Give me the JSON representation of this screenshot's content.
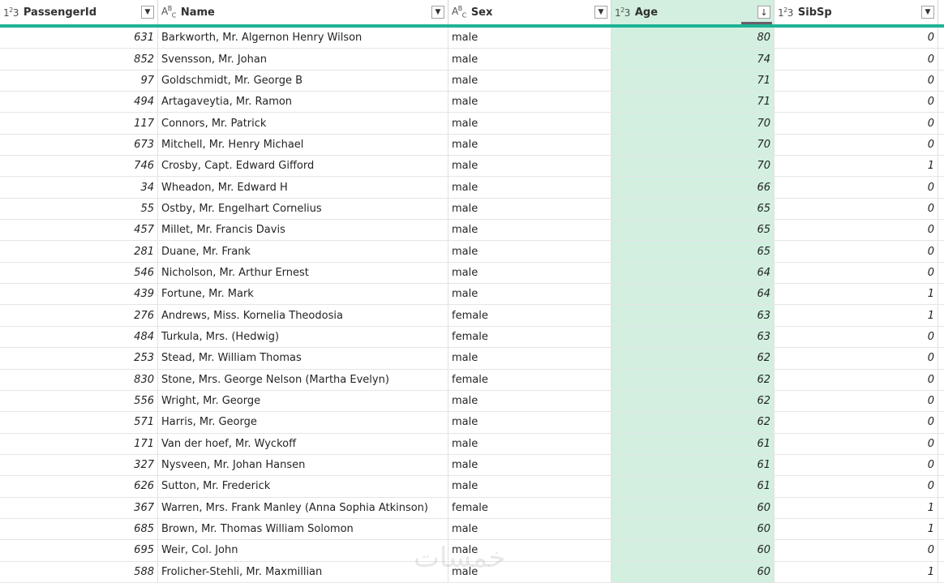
{
  "columns": {
    "passengerid": {
      "type_icon": "1²3",
      "name": "PassengerId"
    },
    "name": {
      "type_icon": "ABC",
      "name": "Name"
    },
    "sex": {
      "type_icon": "ABC",
      "name": "Sex"
    },
    "age": {
      "type_icon": "1²3",
      "name": "Age",
      "sort": "descending"
    },
    "sibsp": {
      "type_icon": "1²3",
      "name": "SibSp"
    }
  },
  "rows": [
    {
      "pid": "631",
      "name": "Barkworth, Mr. Algernon Henry Wilson",
      "sex": "male",
      "age": "80",
      "sibsp": "0"
    },
    {
      "pid": "852",
      "name": "Svensson, Mr. Johan",
      "sex": "male",
      "age": "74",
      "sibsp": "0"
    },
    {
      "pid": "97",
      "name": "Goldschmidt, Mr. George B",
      "sex": "male",
      "age": "71",
      "sibsp": "0"
    },
    {
      "pid": "494",
      "name": "Artagaveytia, Mr. Ramon",
      "sex": "male",
      "age": "71",
      "sibsp": "0"
    },
    {
      "pid": "117",
      "name": "Connors, Mr. Patrick",
      "sex": "male",
      "age": "70",
      "sibsp": "0"
    },
    {
      "pid": "673",
      "name": "Mitchell, Mr. Henry Michael",
      "sex": "male",
      "age": "70",
      "sibsp": "0"
    },
    {
      "pid": "746",
      "name": "Crosby, Capt. Edward Gifford",
      "sex": "male",
      "age": "70",
      "sibsp": "1"
    },
    {
      "pid": "34",
      "name": "Wheadon, Mr. Edward H",
      "sex": "male",
      "age": "66",
      "sibsp": "0"
    },
    {
      "pid": "55",
      "name": "Ostby, Mr. Engelhart Cornelius",
      "sex": "male",
      "age": "65",
      "sibsp": "0"
    },
    {
      "pid": "457",
      "name": "Millet, Mr. Francis Davis",
      "sex": "male",
      "age": "65",
      "sibsp": "0"
    },
    {
      "pid": "281",
      "name": "Duane, Mr. Frank",
      "sex": "male",
      "age": "65",
      "sibsp": "0"
    },
    {
      "pid": "546",
      "name": "Nicholson, Mr. Arthur Ernest",
      "sex": "male",
      "age": "64",
      "sibsp": "0"
    },
    {
      "pid": "439",
      "name": "Fortune, Mr. Mark",
      "sex": "male",
      "age": "64",
      "sibsp": "1"
    },
    {
      "pid": "276",
      "name": "Andrews, Miss. Kornelia Theodosia",
      "sex": "female",
      "age": "63",
      "sibsp": "1"
    },
    {
      "pid": "484",
      "name": "Turkula, Mrs. (Hedwig)",
      "sex": "female",
      "age": "63",
      "sibsp": "0"
    },
    {
      "pid": "253",
      "name": "Stead, Mr. William Thomas",
      "sex": "male",
      "age": "62",
      "sibsp": "0"
    },
    {
      "pid": "830",
      "name": "Stone, Mrs. George Nelson (Martha Evelyn)",
      "sex": "female",
      "age": "62",
      "sibsp": "0"
    },
    {
      "pid": "556",
      "name": "Wright, Mr. George",
      "sex": "male",
      "age": "62",
      "sibsp": "0"
    },
    {
      "pid": "571",
      "name": "Harris, Mr. George",
      "sex": "male",
      "age": "62",
      "sibsp": "0"
    },
    {
      "pid": "171",
      "name": "Van der hoef, Mr. Wyckoff",
      "sex": "male",
      "age": "61",
      "sibsp": "0"
    },
    {
      "pid": "327",
      "name": "Nysveen, Mr. Johan Hansen",
      "sex": "male",
      "age": "61",
      "sibsp": "0"
    },
    {
      "pid": "626",
      "name": "Sutton, Mr. Frederick",
      "sex": "male",
      "age": "61",
      "sibsp": "0"
    },
    {
      "pid": "367",
      "name": "Warren, Mrs. Frank Manley (Anna Sophia Atkinson)",
      "sex": "female",
      "age": "60",
      "sibsp": "1"
    },
    {
      "pid": "685",
      "name": "Brown, Mr. Thomas William Solomon",
      "sex": "male",
      "age": "60",
      "sibsp": "1"
    },
    {
      "pid": "695",
      "name": "Weir, Col. John",
      "sex": "male",
      "age": "60",
      "sibsp": "0"
    },
    {
      "pid": "588",
      "name": "Frolicher-Stehli, Mr. Maxmillian",
      "sex": "male",
      "age": "60",
      "sibsp": "1"
    }
  ],
  "watermark": "خمسات",
  "colors": {
    "accent": "#1db394",
    "sorted_column_bg": "#d2efe0"
  }
}
